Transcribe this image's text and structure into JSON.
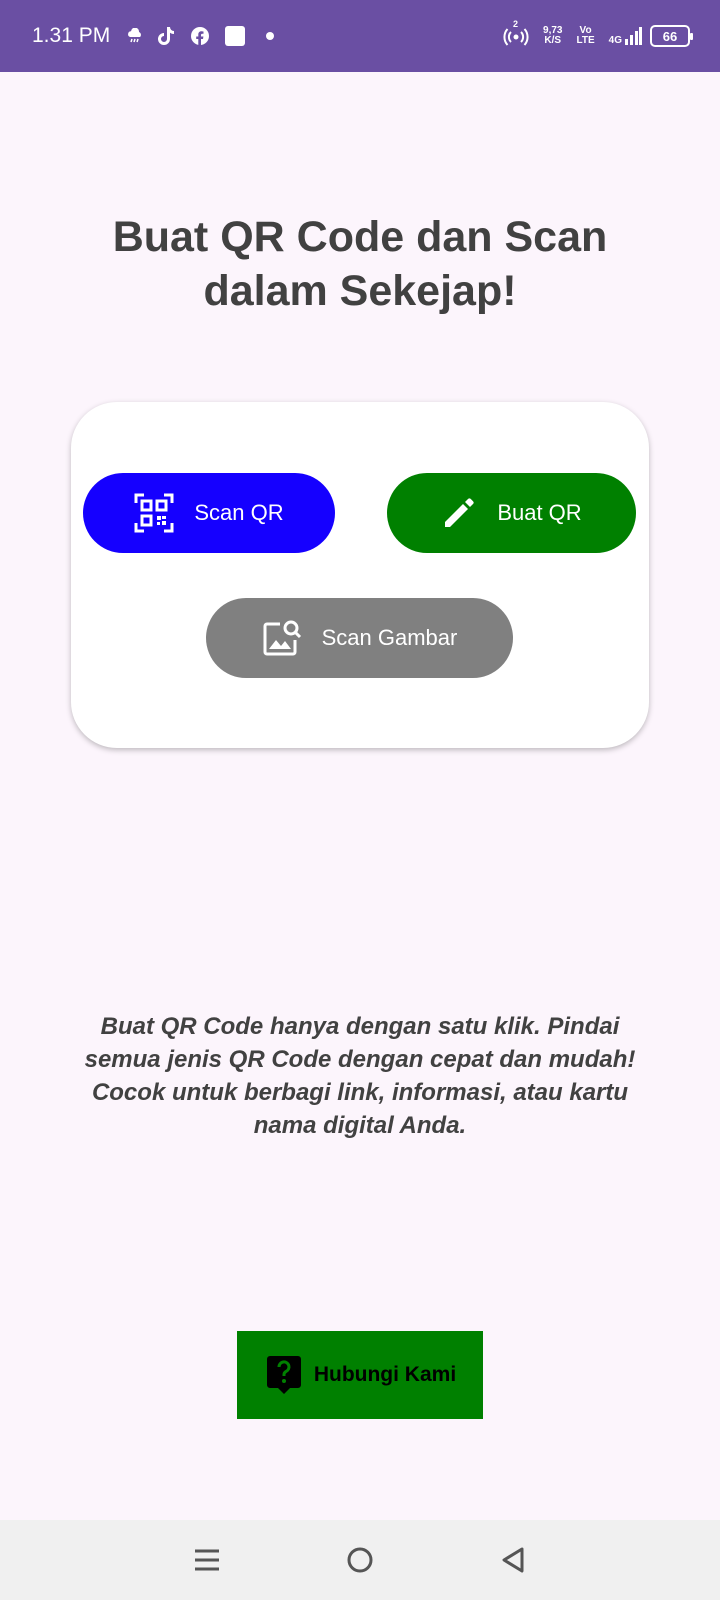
{
  "status_bar": {
    "time": "1.31 PM",
    "speed_value": "9,73",
    "speed_unit": "K/S",
    "volte_top": "Vo",
    "volte_bottom": "LTE",
    "network": "4G",
    "battery": "66",
    "hotspot_badge": "2",
    "icons": [
      "cloud-icon",
      "tiktok-icon",
      "facebook-icon",
      "square-notification-icon",
      "dot-icon",
      "hotspot-icon",
      "signal-icon",
      "battery-icon"
    ]
  },
  "heading": "Buat QR Code dan Scan dalam Sekejap!",
  "buttons": {
    "scan_qr": {
      "label": "Scan QR",
      "icon": "qr-scan-icon",
      "color": "#1500ff"
    },
    "buat_qr": {
      "label": "Buat QR",
      "icon": "pencil-icon",
      "color": "#008000"
    },
    "scan_gambar": {
      "label": "Scan Gambar",
      "icon": "image-search-icon",
      "color": "#808080"
    }
  },
  "description": "Buat QR Code hanya dengan satu klik. Pindai semua jenis QR Code dengan cepat dan mudah! Cocok untuk berbagi link, informasi, atau kartu nama digital Anda.",
  "contact": {
    "label": "Hubungi Kami",
    "icon": "help-bubble-icon",
    "color": "#008000"
  },
  "nav_bar": {
    "icons": [
      "menu-icon",
      "home-icon",
      "back-icon"
    ]
  }
}
